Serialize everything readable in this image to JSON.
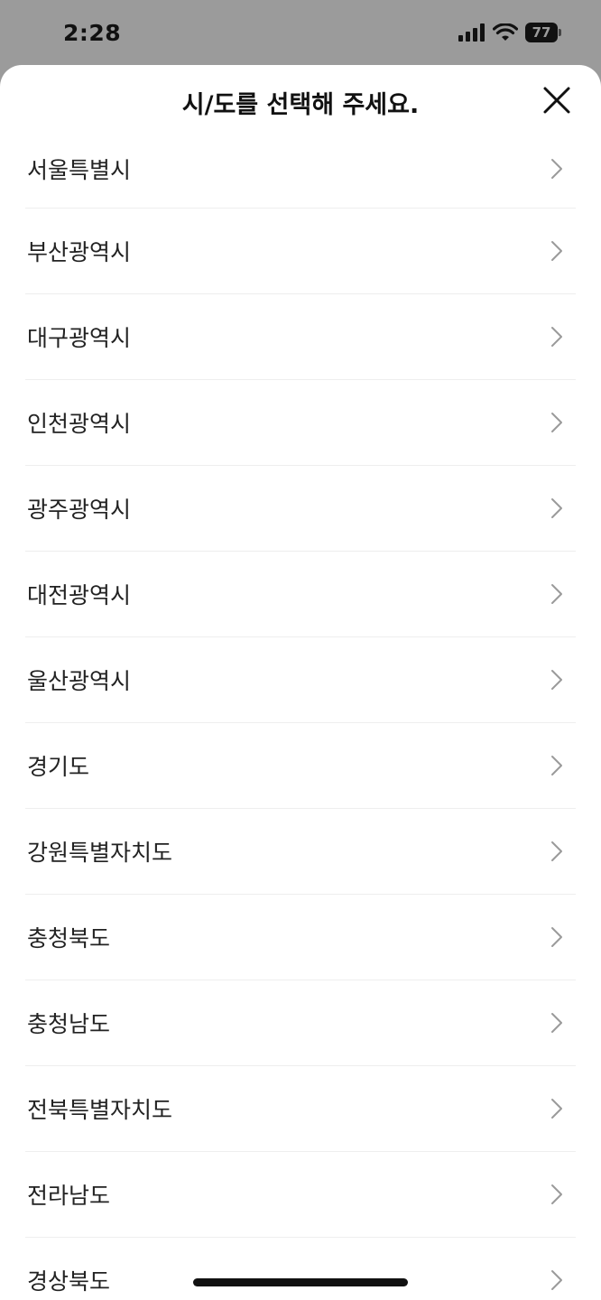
{
  "status_bar": {
    "time": "2:28",
    "battery": "77"
  },
  "sheet": {
    "title": "시/도를 선택해 주세요.",
    "close_icon": "close-icon"
  },
  "regions": [
    {
      "label": "서울특별시"
    },
    {
      "label": "부산광역시"
    },
    {
      "label": "대구광역시"
    },
    {
      "label": "인천광역시"
    },
    {
      "label": "광주광역시"
    },
    {
      "label": "대전광역시"
    },
    {
      "label": "울산광역시"
    },
    {
      "label": "경기도"
    },
    {
      "label": "강원특별자치도"
    },
    {
      "label": "충청북도"
    },
    {
      "label": "충청남도"
    },
    {
      "label": "전북특별자치도"
    },
    {
      "label": "전라남도"
    },
    {
      "label": "경상북도"
    }
  ],
  "colors": {
    "status_bg": "#9b9b9b",
    "sheet_bg": "#ffffff",
    "divider": "#eeeeee",
    "chevron": "#9a9a9a",
    "text": "#222222"
  }
}
